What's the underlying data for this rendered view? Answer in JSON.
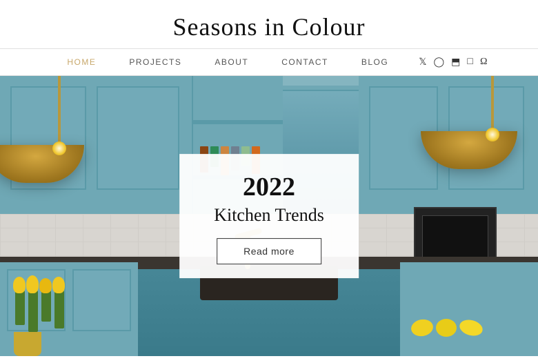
{
  "site": {
    "title": "Seasons in Colour"
  },
  "nav": {
    "items": [
      {
        "label": "HOME",
        "active": true
      },
      {
        "label": "PROJECTS",
        "active": false
      },
      {
        "label": "ABOUT",
        "active": false
      },
      {
        "label": "CONTACT",
        "active": false
      },
      {
        "label": "BLOG",
        "active": false
      }
    ],
    "social_icons": [
      "twitter",
      "instagram",
      "pinterest",
      "facebook",
      "houzz"
    ]
  },
  "hero": {
    "card": {
      "year": "2022",
      "title": "Kitchen Trends",
      "read_more_label": "Read more"
    }
  }
}
